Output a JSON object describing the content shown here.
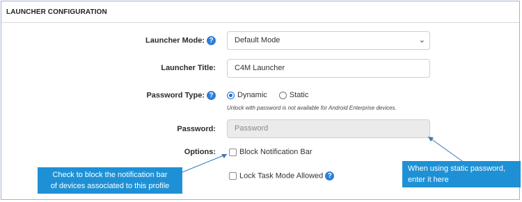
{
  "section": {
    "title": "LAUNCHER CONFIGURATION"
  },
  "fields": {
    "launcher_mode": {
      "label": "Launcher Mode:",
      "value": "Default Mode"
    },
    "launcher_title": {
      "label": "Launcher Title:",
      "value": "C4M Launcher"
    },
    "password_type": {
      "label": "Password Type:",
      "options": [
        "Dynamic",
        "Static"
      ],
      "selected": "Dynamic",
      "note": "Unlock with password is not available for Android Enterprise devices."
    },
    "password": {
      "label": "Password:",
      "placeholder": "Password"
    },
    "options": {
      "label": "Options:",
      "items": [
        {
          "label": "Block Notification Bar",
          "checked": false
        },
        {
          "label": "Lock Task Mode Allowed",
          "checked": false
        }
      ]
    }
  },
  "callouts": {
    "left": {
      "line1": "Check to block the notification bar",
      "line2": "of devices associated to this profile"
    },
    "right": {
      "line1": "When using static password,",
      "line2": "enter it here"
    }
  },
  "icons": {
    "help": "question-mark-circle-icon",
    "chevron": "chevron-down-icon"
  },
  "colors": {
    "accent": "#2f7ed8",
    "callout": "#1e91d6",
    "border": "#9eb3d3"
  }
}
